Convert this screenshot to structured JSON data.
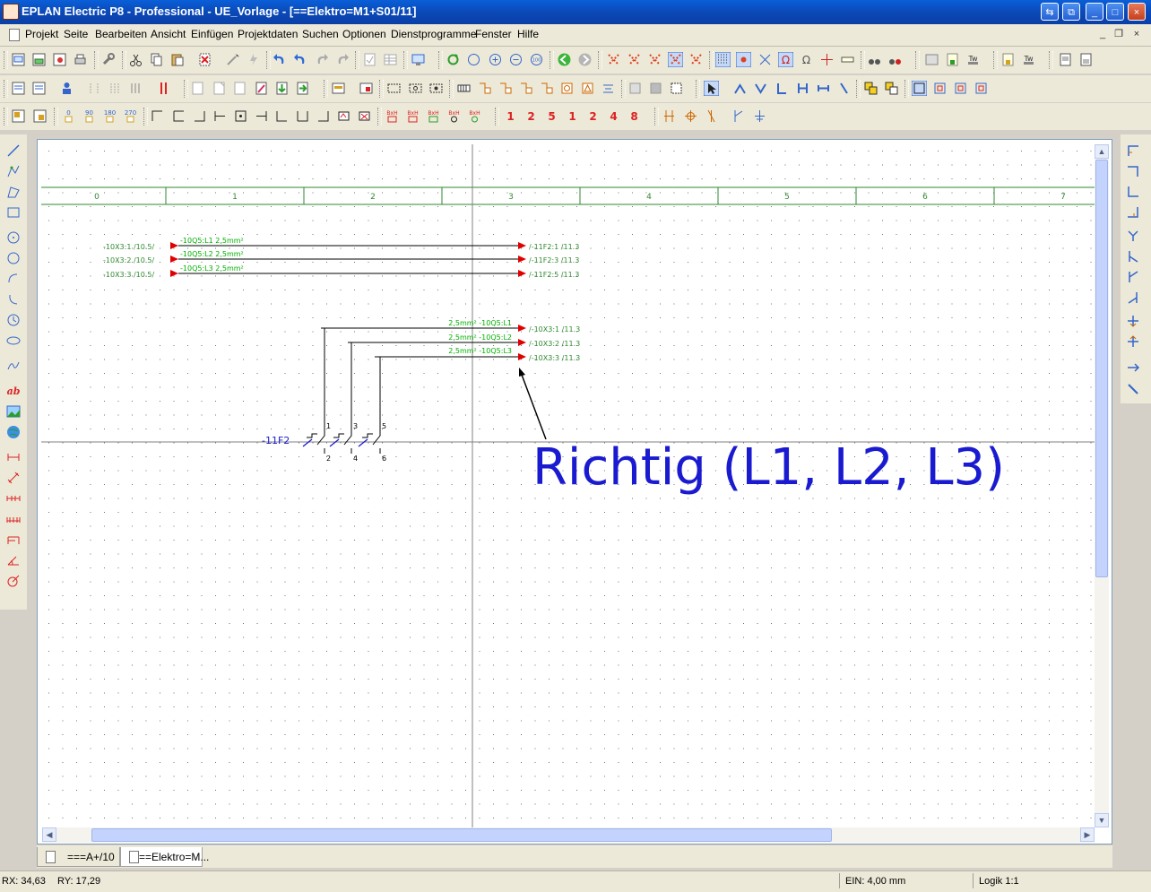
{
  "window": {
    "title": "EPLAN Electric P8 - Professional - UE_Vorlage - [==Elektro=M1+S01/11]",
    "controls": [
      "⇆",
      "⧉",
      "_",
      "□",
      "×"
    ]
  },
  "menu": {
    "items": [
      "Projekt",
      "Seite",
      "Bearbeiten",
      "Ansicht",
      "Einfügen",
      "Projektdaten",
      "Suchen",
      "Optionen",
      "Dienstprogramme",
      "Fenster",
      "Hilfe"
    ],
    "mdi_controls": [
      "_",
      "❐",
      "×"
    ]
  },
  "rotation_buttons": [
    "0",
    "90",
    "180",
    "270"
  ],
  "ruler": {
    "columns": [
      "0",
      "1",
      "2",
      "3",
      "4",
      "5",
      "6",
      "7"
    ]
  },
  "schematic": {
    "incoming": [
      {
        "source": "-10X3:1 /10.5/",
        "wire": "-10Q5:L1 2,5mm²",
        "target": "/-11F2:1 /11.3"
      },
      {
        "source": "-10X3:2 /10.5/",
        "wire": "-10Q5:L2 2,5mm²",
        "target": "/-11F2:3 /11.3"
      },
      {
        "source": "-10X3:3 /10.5/",
        "wire": "-10Q5:L3 2,5mm²",
        "target": "/-11F2:5 /11.3"
      }
    ],
    "outgoing": [
      {
        "wire": "2,5mm² -10Q5:L1",
        "target": "/-10X3:1 /11.3"
      },
      {
        "wire": "2,5mm² -10Q5:L2",
        "target": "/-10X3:2 /11.3"
      },
      {
        "wire": "2,5mm² -10Q5:L3",
        "target": "/-10X3:3 /11.3"
      }
    ],
    "device": {
      "tag": "-11F2",
      "pins_top": [
        "1",
        "3",
        "5"
      ],
      "pins_bottom": [
        "2",
        "4",
        "6"
      ]
    },
    "annotation": "Richtig (L1, L2, L3)",
    "colors": {
      "wire_label": "#00b000",
      "arrow": "#e00000",
      "annotation": "#1a1ad0",
      "ruler": "#2f8a2f"
    }
  },
  "tabs": [
    {
      "label": "===A+/10",
      "active": false
    },
    {
      "label": "==Elektro=M...",
      "active": true
    }
  ],
  "status": {
    "rx": "RX: 34,63",
    "ry": "RY: 17,29",
    "ein": "EIN: 4,00 mm",
    "logik": "Logik 1:1"
  }
}
